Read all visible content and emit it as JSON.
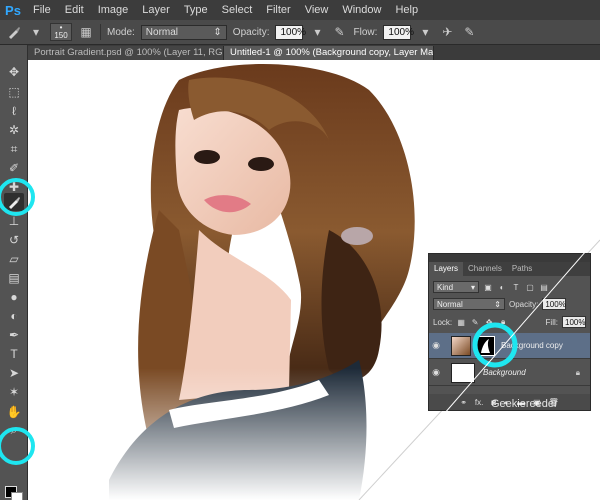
{
  "app": {
    "logo": "Ps"
  },
  "menu": [
    "File",
    "Edit",
    "Image",
    "Layer",
    "Type",
    "Select",
    "Filter",
    "View",
    "Window",
    "Help"
  ],
  "options": {
    "brush_size": "150",
    "mode_label": "Mode:",
    "mode_value": "Normal",
    "opacity_label": "Opacity:",
    "opacity_value": "100%",
    "flow_label": "Flow:",
    "flow_value": "100%"
  },
  "tabs": [
    {
      "label": "Portrait Gradient.psd @ 100% (Layer 11, RGB/8) *",
      "close": "×"
    },
    {
      "label": "Untitled-1 @ 100% (Background copy, Layer Mask/8) *",
      "close": "×"
    }
  ],
  "tools": [
    "move-icon",
    "marquee-icon",
    "lasso-icon",
    "magic-wand-icon",
    "crop-icon",
    "eyedropper-icon",
    "healing-icon",
    "brush-icon",
    "clone-stamp-icon",
    "history-brush-icon",
    "eraser-icon",
    "gradient-icon",
    "blur-icon",
    "dodge-icon",
    "pen-icon",
    "type-icon",
    "path-selection-icon",
    "shape-icon",
    "hand-icon",
    "zoom-icon"
  ],
  "colors": {
    "foreground": "#000000",
    "background": "#ffffff",
    "highlight": "#1ee6f0",
    "selected_layer": "#5d6f88"
  },
  "layers_panel": {
    "tabs": [
      "Layers",
      "Channels",
      "Paths"
    ],
    "kind_label": "Kind",
    "blend_mode": "Normal",
    "opacity_label": "Opacity:",
    "opacity_value": "100%",
    "lock_label": "Lock:",
    "fill_label": "Fill:",
    "fill_value": "100%",
    "layers": [
      {
        "name": "Background copy"
      },
      {
        "name": "Background"
      }
    ],
    "bottom_icons": "fx."
  },
  "watermark": "Geekiereeder"
}
